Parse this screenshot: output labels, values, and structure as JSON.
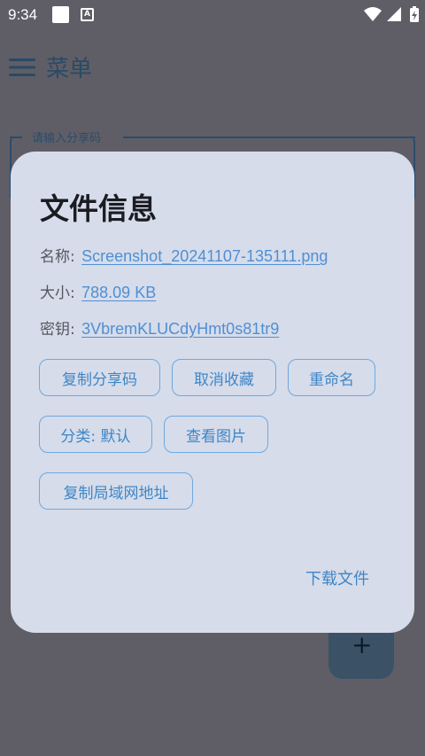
{
  "status_bar": {
    "time": "9:34",
    "a_icon_letter": "A"
  },
  "appbar": {
    "title": "菜单"
  },
  "share_field": {
    "label": "请输入分享码"
  },
  "fab": {
    "glyph": "+"
  },
  "dialog": {
    "title": "文件信息",
    "name_label": "名称:",
    "name_value": "Screenshot_20241107-135111.png",
    "size_label": "大小:",
    "size_value": "788.09 KB",
    "key_label": "密钥:",
    "key_value": "3VbremKLUCdyHmt0s81tr9",
    "buttons": {
      "copy_share_code": "复制分享码",
      "unfavorite": "取消收藏",
      "rename": "重命名",
      "category": "分类: 默认",
      "view_image": "查看图片",
      "copy_lan_address": "复制局域网地址"
    },
    "download": "下载文件"
  },
  "colors": {
    "scrim": "#5f5e66",
    "dialog_bg": "#d6dcea",
    "accent": "#3f86c6",
    "link": "#4f8fd4",
    "button_border": "#6fa8e0"
  }
}
